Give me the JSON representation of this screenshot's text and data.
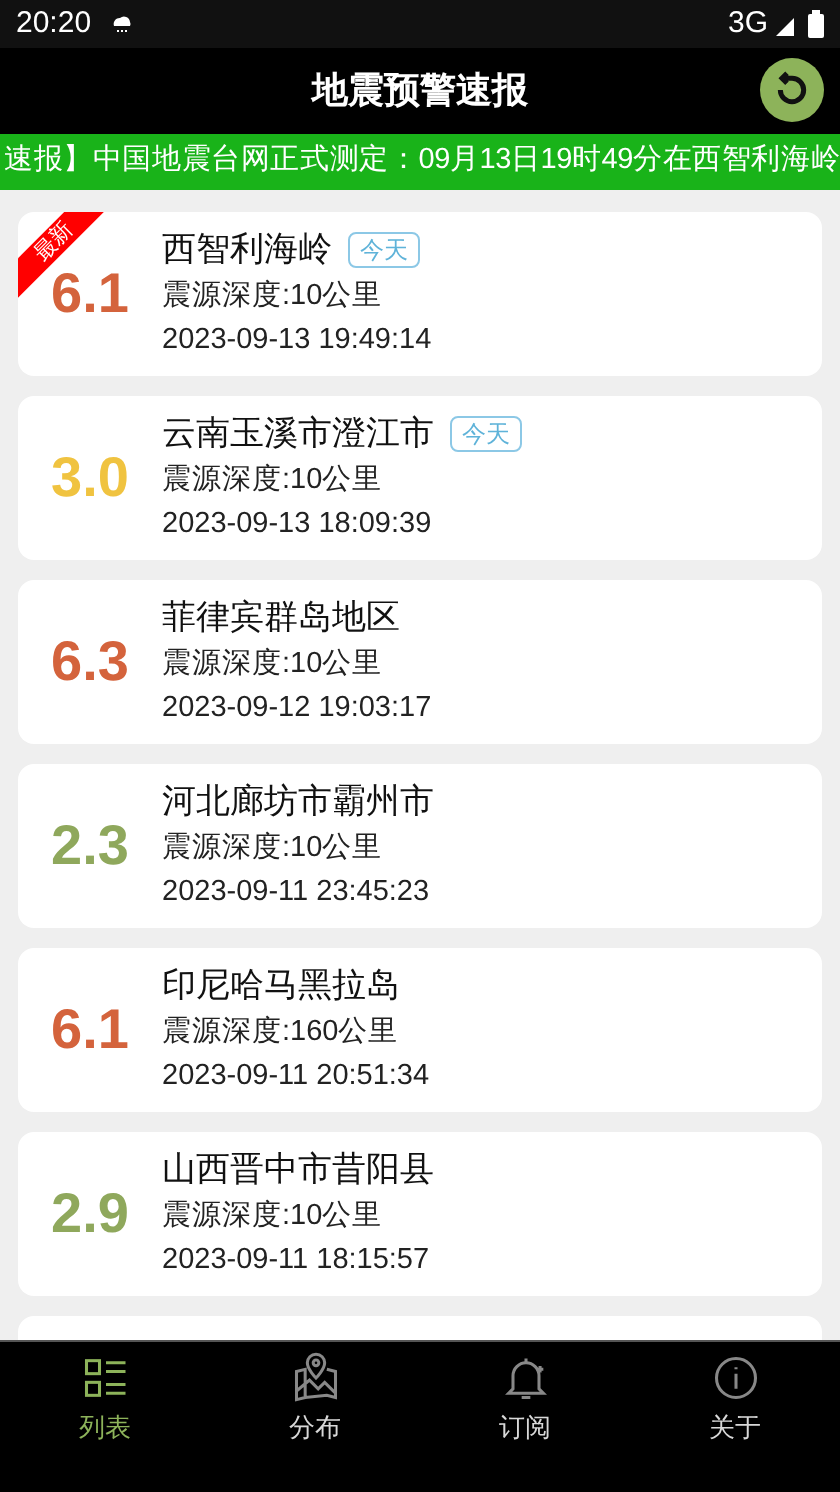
{
  "status_bar": {
    "time": "20:20",
    "network": "3G"
  },
  "header": {
    "title": "地震预警速报"
  },
  "ticker": {
    "text": "速报】中国地震台网正式测定：09月13日19时49分在西智利海岭"
  },
  "quakes": [
    {
      "magnitude": "6.1",
      "color": "#d4633c",
      "place": "西智利海岭",
      "tag": "今天",
      "ribbon": "最新",
      "depth": "震源深度:10公里",
      "time": "2023-09-13 19:49:14"
    },
    {
      "magnitude": "3.0",
      "color": "#f0c340",
      "place": "云南玉溪市澄江市",
      "tag": "今天",
      "depth": "震源深度:10公里",
      "time": "2023-09-13 18:09:39"
    },
    {
      "magnitude": "6.3",
      "color": "#d4633c",
      "place": "菲律宾群岛地区",
      "depth": "震源深度:10公里",
      "time": "2023-09-12 19:03:17"
    },
    {
      "magnitude": "2.3",
      "color": "#8fa85c",
      "place": "河北廊坊市霸州市",
      "depth": "震源深度:10公里",
      "time": "2023-09-11 23:45:23"
    },
    {
      "magnitude": "6.1",
      "color": "#d4633c",
      "place": "印尼哈马黑拉岛",
      "depth": "震源深度:160公里",
      "time": "2023-09-11 20:51:34"
    },
    {
      "magnitude": "2.9",
      "color": "#8fa85c",
      "place": "山西晋中市昔阳县",
      "depth": "震源深度:10公里",
      "time": "2023-09-11 18:15:57"
    }
  ],
  "tabs": [
    {
      "label": "列表",
      "kind": "list",
      "selected": true
    },
    {
      "label": "分布",
      "kind": "map",
      "selected": false
    },
    {
      "label": "订阅",
      "kind": "bell",
      "selected": false
    },
    {
      "label": "关于",
      "kind": "info",
      "selected": false
    }
  ]
}
